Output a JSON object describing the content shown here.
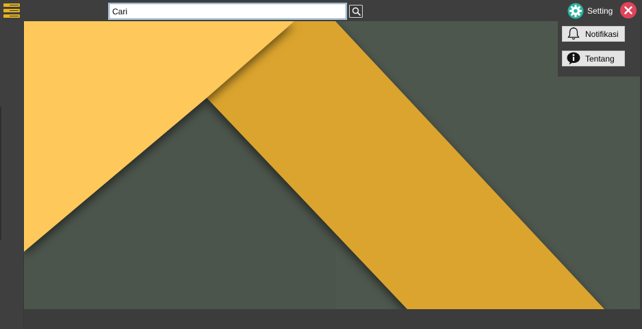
{
  "topbar": {
    "menu_icon": "hamburger-menu-icon",
    "search": {
      "value": "Cari",
      "button_icon": "search-icon"
    },
    "setting": {
      "label": "Setting",
      "icon": "gear-icon",
      "icon_color": "#2bb3a0"
    },
    "close": {
      "icon": "close-icon",
      "color": "#e0445a"
    }
  },
  "dropdown_menu": {
    "items": [
      {
        "label": "Notifikasi",
        "icon": "bell-icon"
      },
      {
        "label": "Tentang",
        "icon": "info-icon"
      }
    ]
  },
  "background": {
    "dark_color": "#4c554c",
    "light_yellow": "#fec95a",
    "dark_yellow": "#dba42d"
  },
  "colors": {
    "chrome": "#3e3e3e",
    "menu_icon": "#e5b21e"
  }
}
